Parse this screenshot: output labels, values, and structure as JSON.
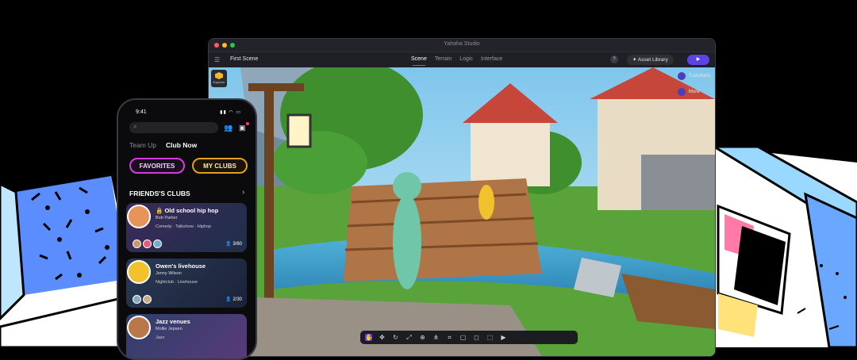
{
  "window": {
    "title": "Yahaha Studio",
    "scene_title": "First Scene",
    "tabs": [
      {
        "label": "Scene",
        "active": true
      },
      {
        "label": "Terrain",
        "active": false
      },
      {
        "label": "Logic",
        "active": false
      },
      {
        "label": "Interface",
        "active": false
      }
    ],
    "help_label": "?",
    "asset_library_label": "Asset Library",
    "play_label": "▶"
  },
  "sidebar_left": {
    "explorer_label": "Explorer"
  },
  "sidebar_right": [
    {
      "label": "Transform",
      "icon": "transform-icon"
    },
    {
      "label": "More",
      "icon": "more-icon"
    }
  ],
  "bottom_toolbar": [
    "hand-icon",
    "move-icon",
    "rotate-icon",
    "scale-icon",
    "rect-tool-icon",
    "pivot-icon",
    "snap-icon",
    "grid-icon",
    "camera-icon",
    "frame-icon",
    "video-icon"
  ],
  "phone": {
    "time": "9:41",
    "tabs": [
      {
        "label": "Team Up",
        "active": false
      },
      {
        "label": "Club Now",
        "active": true
      }
    ],
    "chips": [
      {
        "label": "FAVORITES",
        "color": "#d63be0"
      },
      {
        "label": "MY CLUBS",
        "color": "#e0a020"
      }
    ],
    "section_title": "FRIENDS'S CLUBS",
    "clubs": [
      {
        "name": "Old school hip hop",
        "owner": "Bob Parker",
        "tags": "Comedy · Talkshow · Hiphop",
        "count": "3/60"
      },
      {
        "name": "Owen's livehouse",
        "owner": "Jenny Wilson",
        "tags": "Nightclub · Livehouse",
        "count": "2/30"
      },
      {
        "name": "Jazz venues",
        "owner": "Mollie Jepsen",
        "tags": "Jazz",
        "count": ""
      }
    ]
  }
}
